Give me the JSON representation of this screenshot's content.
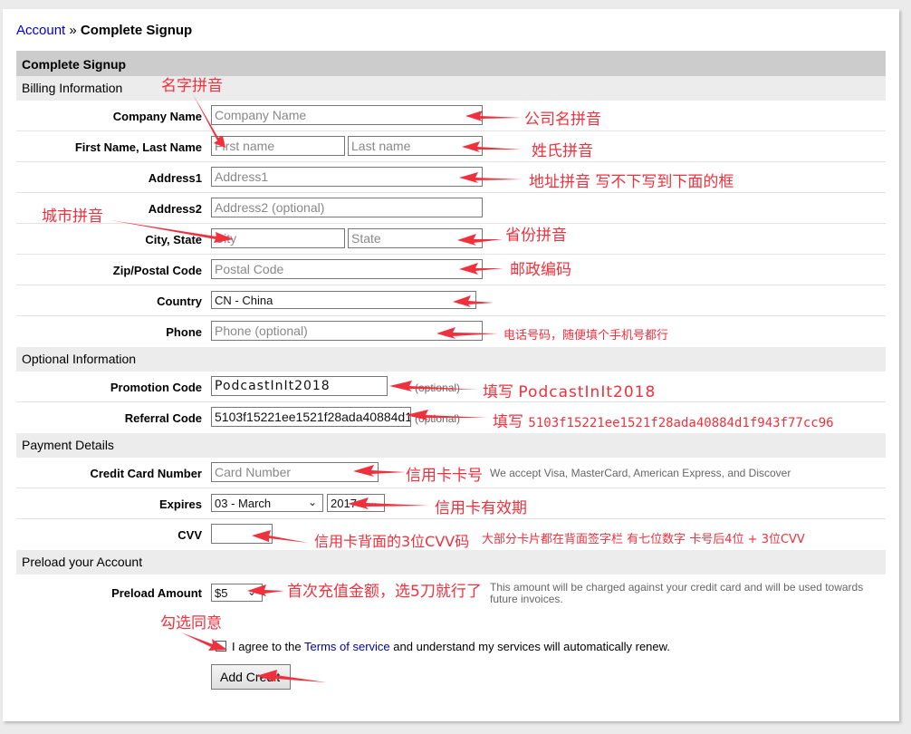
{
  "breadcrumb": {
    "parent": "Account",
    "separator": "»",
    "current": "Complete Signup"
  },
  "form": {
    "title": "Complete Signup",
    "sections": {
      "billing": "Billing Information",
      "optional": "Optional Information",
      "payment": "Payment Details",
      "preload": "Preload your Account"
    },
    "fields": {
      "company": {
        "label": "Company Name",
        "placeholder": "Company Name"
      },
      "name": {
        "label": "First Name, Last Name",
        "first_placeholder": "First name",
        "last_placeholder": "Last name"
      },
      "address1": {
        "label": "Address1",
        "placeholder": "Address1"
      },
      "address2": {
        "label": "Address2",
        "placeholder": "Address2 (optional)"
      },
      "city_state": {
        "label": "City, State",
        "city_placeholder": "City",
        "state_placeholder": "State"
      },
      "zip": {
        "label": "Zip/Postal Code",
        "placeholder": "Postal Code"
      },
      "country": {
        "label": "Country",
        "selected": "CN - China"
      },
      "phone": {
        "label": "Phone",
        "placeholder": "Phone (optional)"
      },
      "promo": {
        "label": "Promotion Code",
        "value": "PodcastInIt2018",
        "note": "(optional)"
      },
      "referral": {
        "label": "Referral Code",
        "value": "5103f15221ee1521f28ada40884d1",
        "note": "(optional)"
      },
      "card": {
        "label": "Credit Card Number",
        "placeholder": "Card Number",
        "note": "We accept Visa, MasterCard, American Express, and Discover"
      },
      "expires": {
        "label": "Expires",
        "month": "03 - March",
        "year": "2017"
      },
      "cvv": {
        "label": "CVV",
        "value": ""
      },
      "preload": {
        "label": "Preload Amount",
        "selected": "$5",
        "note_line1": "This amount will be charged against your credit card and will be used towards",
        "note_line2": "future invoices."
      }
    },
    "agree": {
      "prefix": "I agree to the",
      "link": "Terms of service",
      "suffix": "and understand my services will automatically renew.",
      "checked": false
    },
    "submit_label": "Add Credit"
  },
  "annotations": {
    "name_pinyin": "名字拼音",
    "company_pinyin": "公司名拼音",
    "surname_pinyin": "姓氏拼音",
    "address_pinyin": "地址拼音  写不下写到下面的框",
    "city_pinyin": "城市拼音",
    "province_pinyin": "省份拼音",
    "postal_code": "邮政编码",
    "phone": "电话号码，随便填个手机号都行",
    "promo_prefix": "填写",
    "promo_value": "PodcastInIt2018",
    "referral_prefix": "填写",
    "referral_value": "5103f15221ee1521f28ada40884d1f943f77cc96",
    "card_number": "信用卡卡号",
    "expiry": "信用卡有效期",
    "cvv": "信用卡背面的3位CVV码",
    "cvv_detail": "大部分卡片都在背面签字栏 有七位数字 卡号后4位 + 3位CVV",
    "preload": "首次充值金额，选5刀就行了",
    "agree": "勾选同意"
  },
  "colors": {
    "annotation": "#f0303c",
    "link": "#0000cc",
    "header_bg": "#cccccc",
    "section_bg": "#ececec"
  }
}
